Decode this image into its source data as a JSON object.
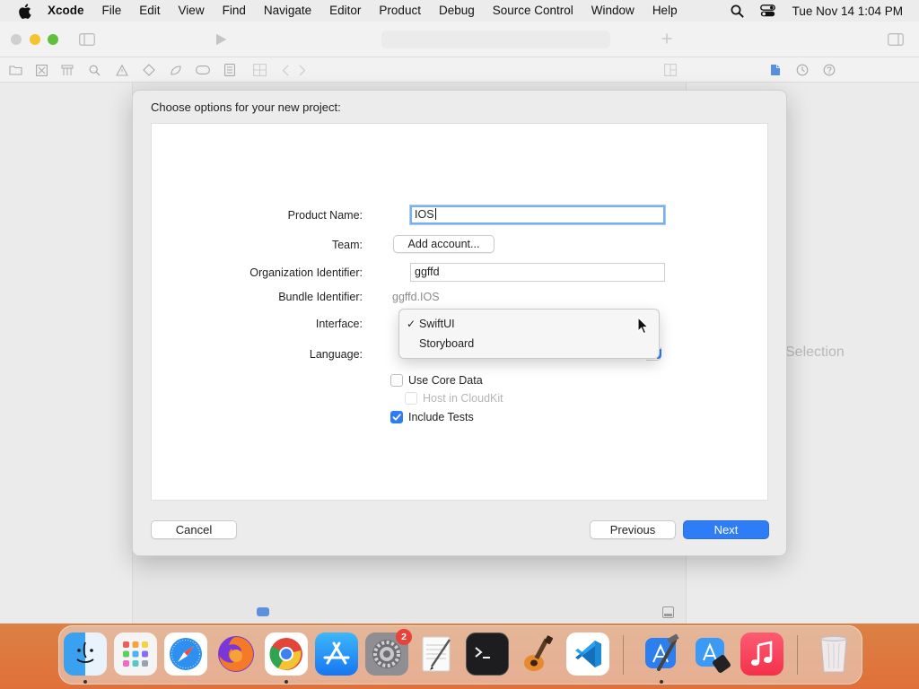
{
  "menubar": {
    "app_name": "Xcode",
    "items": [
      "File",
      "Edit",
      "View",
      "Find",
      "Navigate",
      "Editor",
      "Product",
      "Debug",
      "Source Control",
      "Window",
      "Help"
    ],
    "clock": "Tue Nov 14  1:04 PM"
  },
  "inspector": {
    "empty_text": "Selection"
  },
  "dialog": {
    "title": "Choose options for your new project:",
    "product_name_label": "Product Name:",
    "product_name_value": "IOS",
    "team_label": "Team:",
    "team_button": "Add account...",
    "org_id_label": "Organization Identifier:",
    "org_id_value": "ggffd",
    "bundle_id_label": "Bundle Identifier:",
    "bundle_id_value": "ggffd.IOS",
    "interface_label": "Interface:",
    "interface_options": [
      "SwiftUI",
      "Storyboard"
    ],
    "interface_selected": "SwiftUI",
    "check_mark": "✓",
    "language_label": "Language:",
    "use_core_data_label": "Use Core Data",
    "use_core_data_checked": false,
    "host_cloudkit_label": "Host in CloudKit",
    "host_cloudkit_checked": false,
    "include_tests_label": "Include Tests",
    "include_tests_checked": true,
    "cancel_button": "Cancel",
    "previous_button": "Previous",
    "next_button": "Next"
  },
  "dock": {
    "apps": [
      "Finder",
      "Launchpad",
      "Safari",
      "Firefox",
      "Chrome",
      "App Store",
      "System Settings",
      "TextEdit",
      "Terminal",
      "GarageBand",
      "Visual Studio Code",
      "Xcode",
      "Simulator",
      "Music",
      "Trash"
    ],
    "system_settings_badge": "2"
  },
  "colors": {
    "accent": "#2f7df6",
    "focus_ring": "#7aaef0",
    "badge": "#e8433b"
  }
}
